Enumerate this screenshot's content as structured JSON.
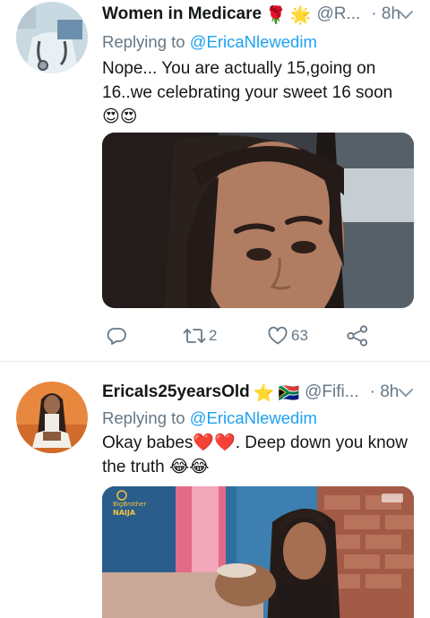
{
  "tweets": [
    {
      "author": "Women in Medicare",
      "badges": [
        "🌹",
        "🌟"
      ],
      "handle": "@R...",
      "time": "· 8h",
      "replying_label": "Replying to",
      "replying_to": "@EricaNlewedim",
      "text_line1": "Nope... You are actually 15,going on",
      "text_line2": "16..we celebrating your sweet 16 soon",
      "text_line3": "😍😍",
      "actions": {
        "reply": "",
        "retweet": "2",
        "like": "63",
        "share": ""
      }
    },
    {
      "author": "EricaIs25yearsOld",
      "badges": [
        "⭐",
        "🇿🇦"
      ],
      "handle": "@Fifi...",
      "time": "· 8h",
      "replying_label": "Replying to",
      "replying_to": "@EricaNlewedim",
      "text_line1_a": "Okay babes",
      "text_line1_hearts": "❤️❤️",
      "text_line1_b": ". Deep down you know",
      "text_line2": "the truth 😂😂",
      "media_logo_line1": "BigBrother",
      "media_logo_line2": "NAIJA"
    }
  ],
  "icons": [
    "reply-icon",
    "retweet-icon",
    "like-icon",
    "share-icon",
    "chevron-down-icon"
  ],
  "colors": {
    "link": "#1da1f2",
    "secondary_text": "#657786",
    "primary_text": "#14171a",
    "divider": "#e6ecf0"
  }
}
